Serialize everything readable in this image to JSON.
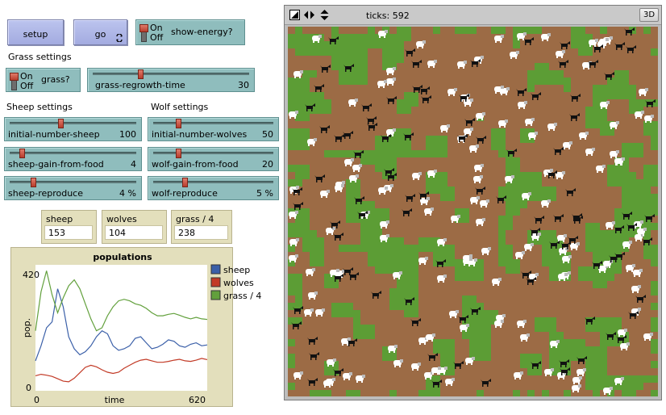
{
  "buttons": {
    "setup": "setup",
    "go": "go"
  },
  "switches": {
    "show_energy": {
      "on": "On",
      "off": "Off",
      "label": "show-energy?"
    },
    "grass": {
      "on": "On",
      "off": "Off",
      "label": "grass?"
    }
  },
  "headings": {
    "grass": "Grass settings",
    "sheep": "Sheep settings",
    "wolf": "Wolf settings"
  },
  "sliders": {
    "grass_regrowth_time": {
      "label": "grass-regrowth-time",
      "value": "30",
      "fraction": 0.3
    },
    "initial_number_sheep": {
      "label": "initial-number-sheep",
      "value": "100",
      "fraction": 0.4
    },
    "initial_number_wolves": {
      "label": "initial-number-wolves",
      "value": "50",
      "fraction": 0.2
    },
    "sheep_gain_from_food": {
      "label": "sheep-gain-from-food",
      "value": "4",
      "fraction": 0.08
    },
    "wolf_gain_from_food": {
      "label": "wolf-gain-from-food",
      "value": "20",
      "fraction": 0.2
    },
    "sheep_reproduce": {
      "label": "sheep-reproduce",
      "value": "4 %",
      "fraction": 0.17
    },
    "wolf_reproduce": {
      "label": "wolf-reproduce",
      "value": "5 %",
      "fraction": 0.25
    }
  },
  "monitors": {
    "sheep": {
      "label": "sheep",
      "value": "153"
    },
    "wolves": {
      "label": "wolves",
      "value": "104"
    },
    "grass": {
      "label": "grass / 4",
      "value": "238"
    }
  },
  "world": {
    "ticks_label": "ticks: 592",
    "three_d_label": "3D",
    "grass_color": "#5c9d35",
    "dirt_color": "#9c6b45"
  },
  "chart_data": {
    "type": "line",
    "title": "populations",
    "xlabel": "time",
    "ylabel": "pop.",
    "xlim": [
      0,
      620
    ],
    "ylim": [
      0,
      420
    ],
    "x_tick_labels": [
      "0",
      "620"
    ],
    "y_tick_labels": [
      "0",
      "420"
    ],
    "legend_position": "right",
    "x": [
      0,
      20,
      40,
      60,
      80,
      100,
      120,
      140,
      160,
      180,
      200,
      220,
      240,
      260,
      280,
      300,
      320,
      340,
      360,
      380,
      400,
      420,
      440,
      460,
      480,
      500,
      520,
      540,
      560,
      580,
      600,
      620
    ],
    "series": [
      {
        "name": "sheep",
        "color": "#3a5fa8",
        "values": [
          100,
          150,
          210,
          230,
          340,
          280,
          180,
          140,
          120,
          130,
          150,
          180,
          200,
          190,
          150,
          135,
          140,
          150,
          175,
          180,
          160,
          140,
          145,
          155,
          170,
          165,
          150,
          145,
          155,
          160,
          150,
          153
        ]
      },
      {
        "name": "wolves",
        "color": "#c23a26",
        "values": [
          50,
          55,
          52,
          48,
          40,
          32,
          30,
          42,
          60,
          78,
          85,
          80,
          70,
          62,
          58,
          62,
          75,
          85,
          95,
          102,
          105,
          100,
          95,
          95,
          98,
          102,
          105,
          100,
          98,
          102,
          108,
          104
        ]
      },
      {
        "name": "grass / 4",
        "color": "#62a03c",
        "values": [
          200,
          330,
          400,
          320,
          260,
          310,
          350,
          370,
          340,
          290,
          240,
          200,
          210,
          250,
          280,
          300,
          305,
          300,
          290,
          285,
          275,
          260,
          250,
          250,
          255,
          258,
          252,
          245,
          240,
          245,
          240,
          238
        ]
      }
    ]
  }
}
